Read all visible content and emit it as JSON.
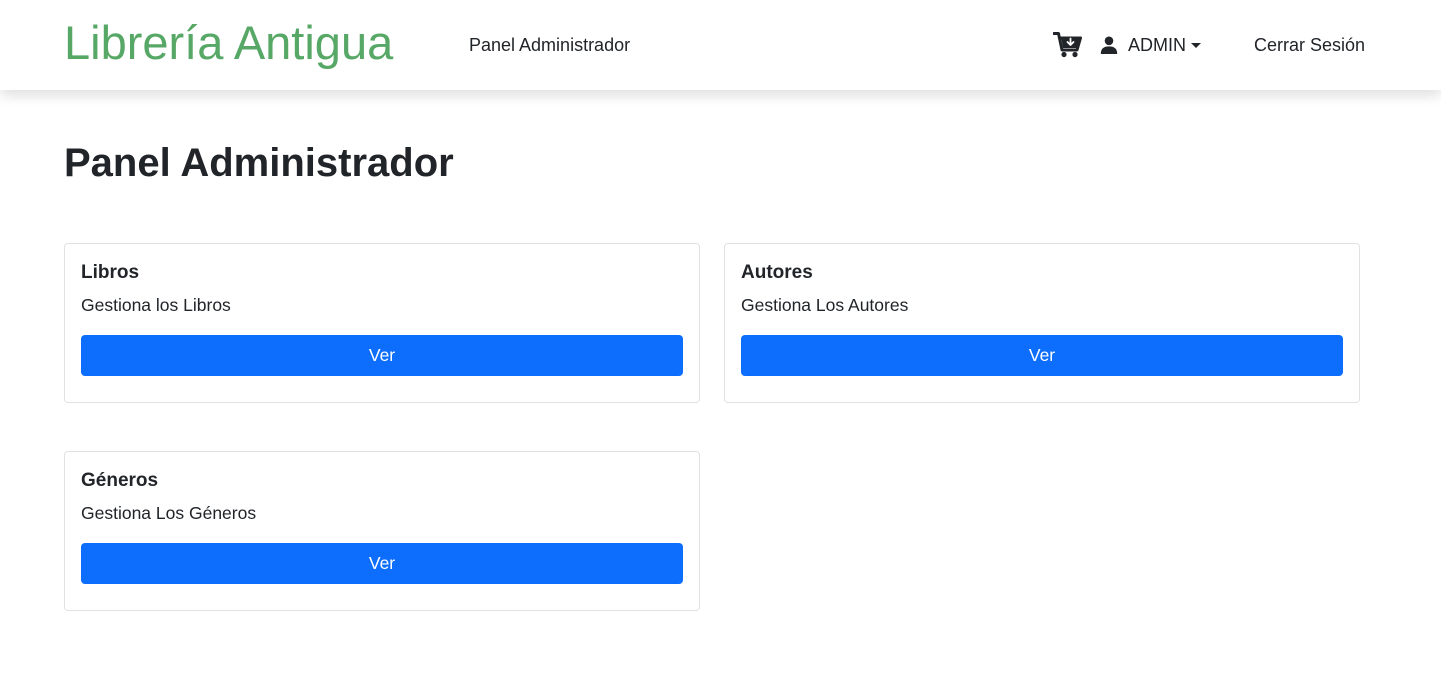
{
  "navbar": {
    "brand": "Librería Antigua",
    "panel_link": "Panel Administrador",
    "cart_icon": "cart-plus-icon",
    "user_icon": "user-icon",
    "user_label": "ADMIN",
    "logout_link": "Cerrar Sesión"
  },
  "page": {
    "title": "Panel Administrador"
  },
  "cards": [
    {
      "title": "Libros",
      "text": "Gestiona los Libros",
      "button": "Ver"
    },
    {
      "title": "Autores",
      "text": "Gestiona Los Autores",
      "button": "Ver"
    },
    {
      "title": "Géneros",
      "text": "Gestiona Los Géneros",
      "button": "Ver"
    }
  ],
  "colors": {
    "brand": "#57a866",
    "primary_button": "#0d6efd",
    "text": "#212529",
    "card_border": "#dfe1e4"
  }
}
